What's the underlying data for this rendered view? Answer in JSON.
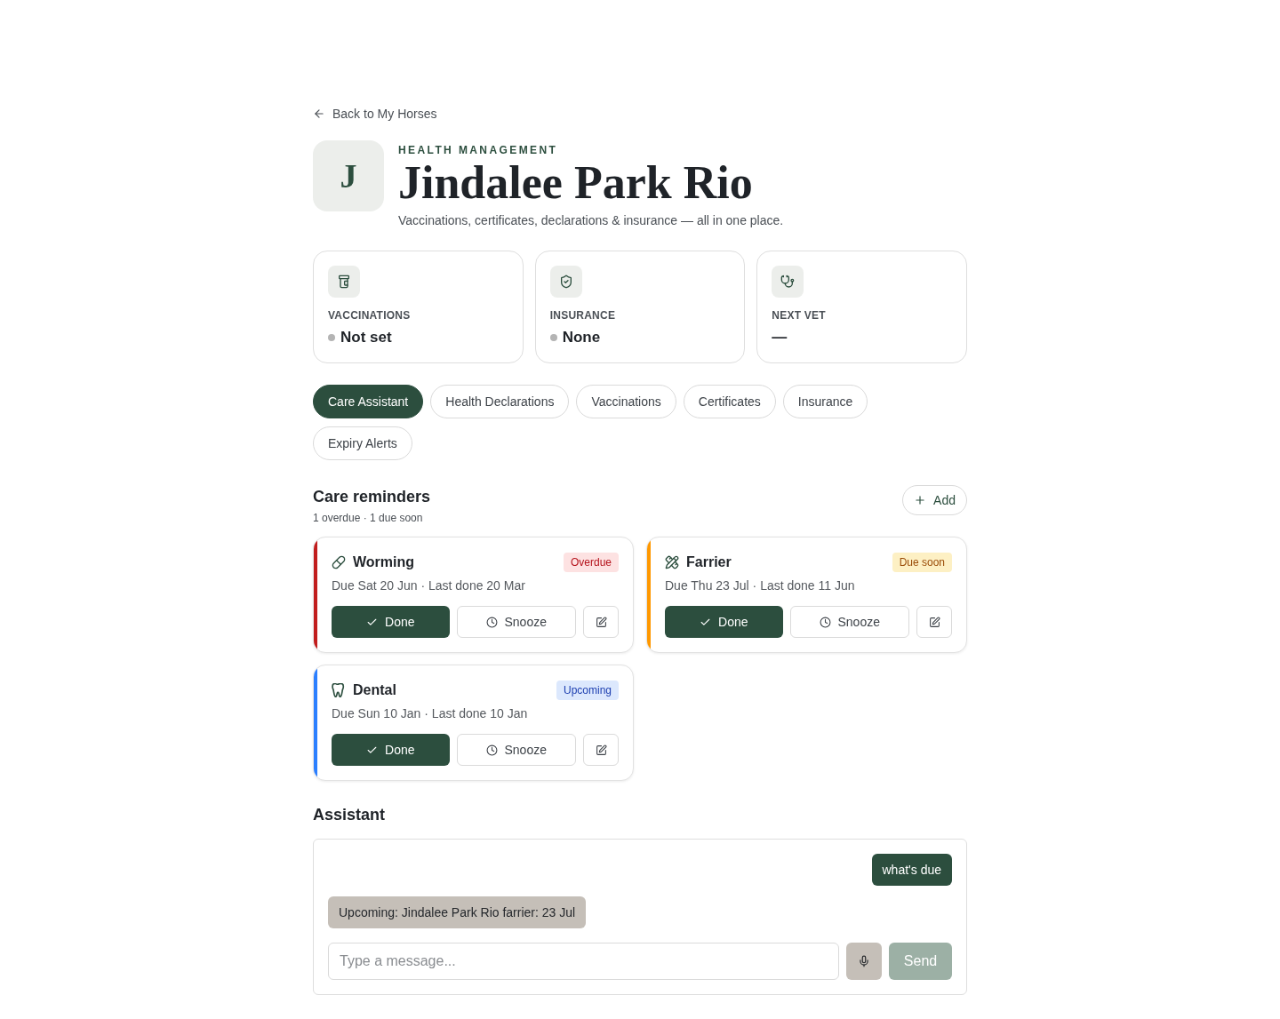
{
  "back_link": {
    "label": "Back to My Horses"
  },
  "header": {
    "avatar_letter": "J",
    "eyebrow": "HEALTH MANAGEMENT",
    "title": "Jindalee Park Rio",
    "subtitle": "Vaccinations, certificates, declarations & insurance — all in one place."
  },
  "stats": [
    {
      "label": "VACCINATIONS",
      "value": "Not set",
      "color": "#b4b4b4"
    },
    {
      "label": "INSURANCE",
      "value": "None",
      "color": "#b4b4b4"
    },
    {
      "label": "NEXT VET",
      "value": "—"
    }
  ],
  "tabs": [
    {
      "label": "Care Assistant",
      "selected": true
    },
    {
      "label": "Health Declarations",
      "selected": false
    },
    {
      "label": "Vaccinations",
      "selected": false
    },
    {
      "label": "Certificates",
      "selected": false
    },
    {
      "label": "Insurance",
      "selected": false
    },
    {
      "label": "Expiry Alerts",
      "selected": false
    }
  ],
  "care_reminders": {
    "title": "Care reminders",
    "summary": "1 overdue · 1 due soon",
    "add_button": "Add",
    "items": [
      {
        "title": "Worming",
        "badge": "Overdue",
        "kind": "overdue",
        "color": "#c11d1d",
        "due": "Due Sat 20 Jun · Last done 20 Mar",
        "done_button": "Done",
        "snooze_button": "Snooze"
      },
      {
        "title": "Farrier",
        "badge": "Due soon",
        "kind": "due_soon",
        "color": "#ff9800",
        "due": "Due Thu 23 Jul · Last done 11 Jun",
        "done_button": "Done",
        "snooze_button": "Snooze"
      },
      {
        "title": "Dental",
        "badge": "Upcoming",
        "kind": "upcoming",
        "color": "#2b7fff",
        "due": "Due Sun 10 Jan · Last done 10 Jan",
        "done_button": "Done",
        "snooze_button": "Snooze"
      }
    ]
  },
  "assistant": {
    "title": "Assistant",
    "messages": [
      {
        "kind": "user",
        "text": "what's due"
      },
      {
        "kind": "assistant",
        "text": "Upcoming: Jindalee Park Rio farrier: 23 Jul"
      }
    ],
    "input": {
      "placeholder": "Type a message..."
    },
    "send_button": {
      "label": "Send",
      "disabled": true
    }
  }
}
